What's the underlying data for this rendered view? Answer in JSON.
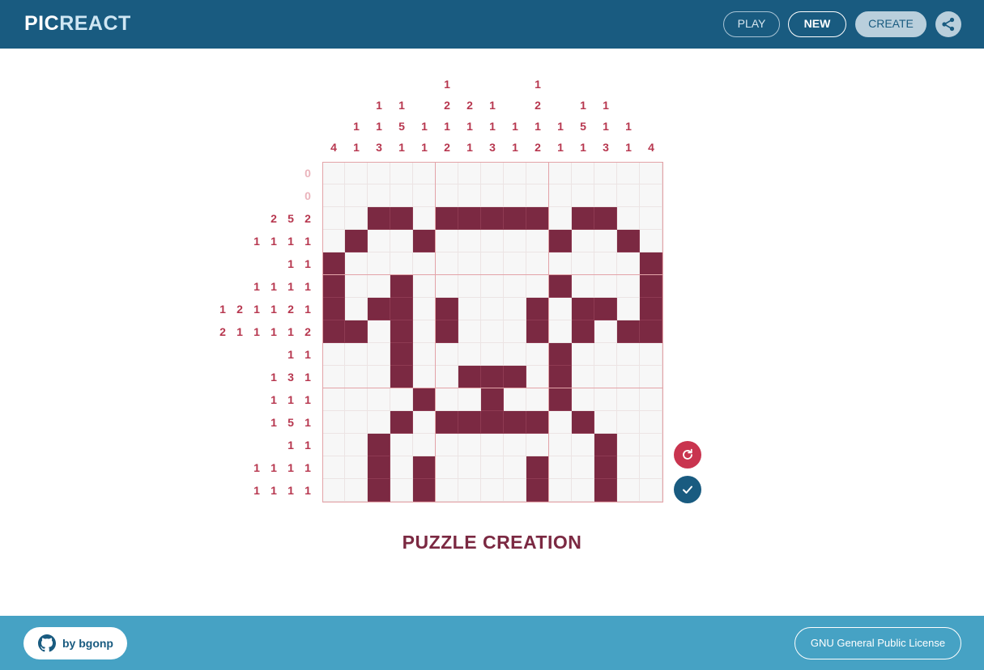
{
  "header": {
    "logo_prefix": "PIC",
    "logo_suffix": "REACT",
    "play_label": "PLAY",
    "new_label": "NEW",
    "create_label": "CREATE",
    "share_icon": "share-icon"
  },
  "puzzle": {
    "title": "PUZZLE CREATION",
    "rows": [
      "...............",
      "...............",
      "..XX.XXXXX.XX..",
      ".X..X.....X..X.",
      "X.............X",
      "X..X......X...X",
      "X.XX.X...X.XX.X",
      "XX.X.X...X.X.XX",
      "...X......X....",
      "...X..XXX.X....",
      "....X..X..X....",
      "...X.XXXXX.X...",
      "..X.........X..",
      "..X.X....X..X..",
      "..X.X....X..X.."
    ],
    "column_clues": [
      [
        "4"
      ],
      [
        "1",
        "1"
      ],
      [
        "1",
        "1",
        "3"
      ],
      [
        "1",
        "5",
        "1"
      ],
      [
        "1",
        "1"
      ],
      [
        "1",
        "2",
        "1",
        "2"
      ],
      [
        "2",
        "1",
        "1"
      ],
      [
        "1",
        "1",
        "3"
      ],
      [
        "1",
        "1"
      ],
      [
        "1",
        "2",
        "1",
        "2"
      ],
      [
        "1",
        "1"
      ],
      [
        "1",
        "5",
        "1"
      ],
      [
        "1",
        "1",
        "3"
      ],
      [
        "1",
        "1"
      ],
      [
        "4"
      ]
    ],
    "row_clues": [
      [
        "0"
      ],
      [
        "0"
      ],
      [
        "2",
        "5",
        "2"
      ],
      [
        "1",
        "1",
        "1",
        "1"
      ],
      [
        "1",
        "1"
      ],
      [
        "1",
        "1",
        "1",
        "1"
      ],
      [
        "1",
        "2",
        "1",
        "1",
        "2",
        "1"
      ],
      [
        "2",
        "1",
        "1",
        "1",
        "1",
        "2"
      ],
      [
        "1",
        "1"
      ],
      [
        "1",
        "3",
        "1"
      ],
      [
        "1",
        "1",
        "1"
      ],
      [
        "1",
        "5",
        "1"
      ],
      [
        "1",
        "1"
      ],
      [
        "1",
        "1",
        "1",
        "1"
      ],
      [
        "1",
        "1",
        "1",
        "1"
      ]
    ],
    "colors": {
      "filled": "#7b2942",
      "clue": "#b7374f",
      "zero_clue": "#eab4bc",
      "grid": "#e3a3a8"
    },
    "reset_icon": "reset-icon",
    "confirm_icon": "check-icon"
  },
  "footer": {
    "author_label": "by bgonp",
    "author_icon": "github-icon",
    "license_label": "GNU General Public License"
  }
}
